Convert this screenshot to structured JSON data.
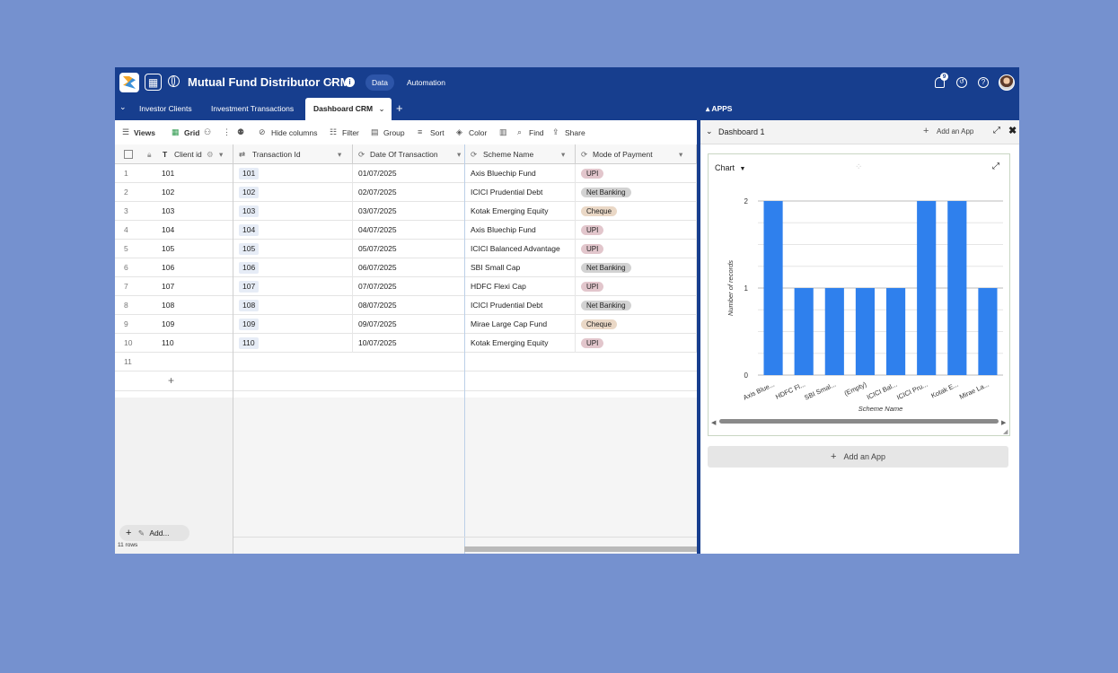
{
  "topbar": {
    "title": "Mutual Fund Distributor CRM",
    "data_label": "Data",
    "automation_label": "Automation",
    "notif_count": "9"
  },
  "tabs": [
    {
      "label": "Investor Clients"
    },
    {
      "label": "Investment Transactions"
    },
    {
      "label": "Dashboard CRM"
    }
  ],
  "toolbar": {
    "views": "Views",
    "grid": "Grid",
    "hide_columns": "Hide columns",
    "filter": "Filter",
    "group": "Group",
    "sort": "Sort",
    "color": "Color",
    "find": "Find",
    "share": "Share"
  },
  "columns": {
    "client_id": "Client id",
    "transaction_id": "Transaction Id",
    "date": "Date Of Transaction",
    "scheme": "Scheme Name",
    "payment": "Mode of Payment"
  },
  "rows": [
    {
      "n": "1",
      "client": "101",
      "txn": "101",
      "date": "01/07/2025",
      "scheme": "Axis Bluechip Fund",
      "pay": "UPI"
    },
    {
      "n": "2",
      "client": "102",
      "txn": "102",
      "date": "02/07/2025",
      "scheme": "ICICI Prudential Debt",
      "pay": "Net Banking"
    },
    {
      "n": "3",
      "client": "103",
      "txn": "103",
      "date": "03/07/2025",
      "scheme": "Kotak Emerging Equity",
      "pay": "Cheque"
    },
    {
      "n": "4",
      "client": "104",
      "txn": "104",
      "date": "04/07/2025",
      "scheme": "Axis Bluechip Fund",
      "pay": "UPI"
    },
    {
      "n": "5",
      "client": "105",
      "txn": "105",
      "date": "05/07/2025",
      "scheme": "ICICI Balanced Advantage",
      "pay": "UPI"
    },
    {
      "n": "6",
      "client": "106",
      "txn": "106",
      "date": "06/07/2025",
      "scheme": "SBI Small Cap",
      "pay": "Net Banking"
    },
    {
      "n": "7",
      "client": "107",
      "txn": "107",
      "date": "07/07/2025",
      "scheme": "HDFC Flexi Cap",
      "pay": "UPI"
    },
    {
      "n": "8",
      "client": "108",
      "txn": "108",
      "date": "08/07/2025",
      "scheme": "ICICI Prudential Debt",
      "pay": "Net Banking"
    },
    {
      "n": "9",
      "client": "109",
      "txn": "109",
      "date": "09/07/2025",
      "scheme": "Mirae Large Cap Fund",
      "pay": "Cheque"
    },
    {
      "n": "10",
      "client": "110",
      "txn": "110",
      "date": "10/07/2025",
      "scheme": "Kotak Emerging Equity",
      "pay": "UPI"
    }
  ],
  "empty_row_num": "11",
  "footer": {
    "add_label": "Add...",
    "rows_count": "11 rows"
  },
  "pay_colors": {
    "UPI": "#e2c6cc",
    "Net Banking": "#d2d2d2",
    "Cheque": "#ead8c6"
  },
  "apps": {
    "header": "APPS",
    "dashboard": "Dashboard 1",
    "add_app": "Add an App",
    "chart_label": "Chart",
    "add_app_bottom": "Add an App"
  },
  "chart_data": {
    "type": "bar",
    "categories": [
      "Axis Blue...",
      "HDFC Fl...",
      "SBI Smal...",
      "(Empty)",
      "ICICI Bal...",
      "ICICI Pru...",
      "Kotak E...",
      "Mirae La..."
    ],
    "values": [
      2,
      1,
      1,
      1,
      1,
      2,
      2,
      1
    ],
    "xlabel": "Scheme Name",
    "ylabel": "Number of records",
    "yticks": [
      "0",
      "1",
      "2"
    ],
    "ylim": [
      0,
      2
    ],
    "bar_color": "#2f80ed",
    "grid": true
  }
}
